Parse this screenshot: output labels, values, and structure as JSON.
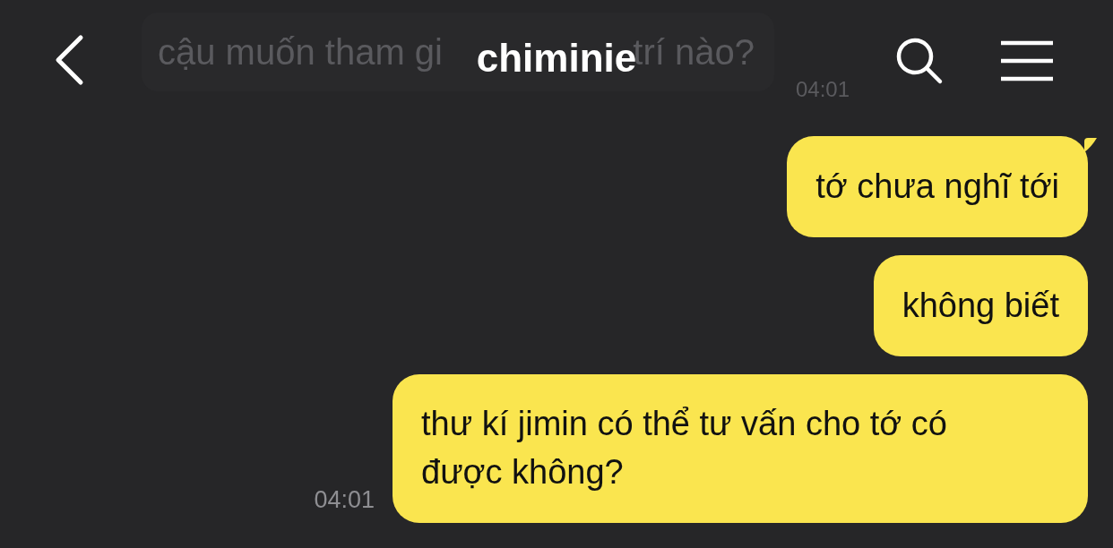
{
  "header": {
    "title": "chiminie",
    "faded_message": {
      "text_before": "cậu muốn tham gi",
      "text_after": "trí nào?",
      "time": "04:01"
    }
  },
  "messages": [
    {
      "text": "tớ chưa nghĩ tới",
      "tail": true
    },
    {
      "text": "không biết",
      "tail": false
    },
    {
      "text": "thư kí jimin có thể tư vấn cho tớ có được không?",
      "tail": false,
      "time": "04:01"
    }
  ]
}
